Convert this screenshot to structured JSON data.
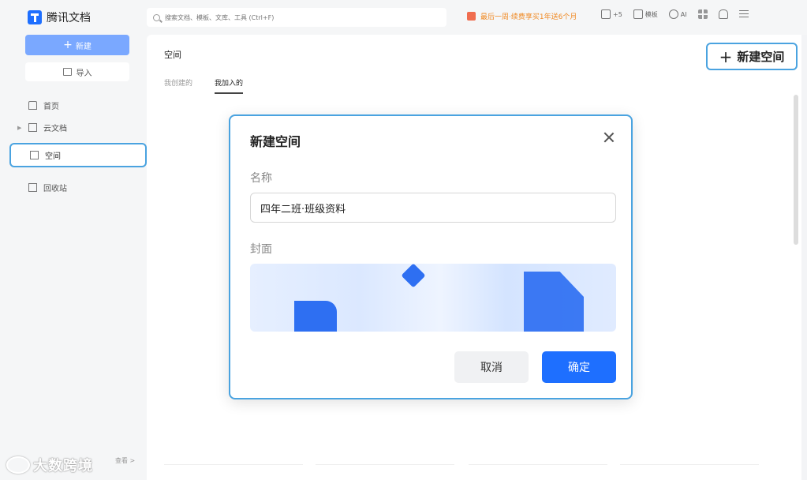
{
  "app": {
    "name": "腾讯文档"
  },
  "search": {
    "placeholder": "搜索文档、模板、文库、工具 (Ctrl+F)"
  },
  "promo": {
    "text": "最后一周·续费享买1年送6个月"
  },
  "top_tools": [
    {
      "label": "+5",
      "icon": "collab-icon"
    },
    {
      "label": "模板",
      "icon": "template-icon"
    },
    {
      "label": "AI",
      "icon": "ai-icon"
    },
    {
      "label": "",
      "icon": "apps-grid-icon"
    },
    {
      "label": "",
      "icon": "bell-icon"
    },
    {
      "label": "",
      "icon": "menu-icon"
    }
  ],
  "sidebar": {
    "new_label": "新建",
    "import_label": "导入",
    "items": [
      {
        "label": "首页",
        "icon": "home-icon"
      },
      {
        "label": "云文档",
        "icon": "doc-icon"
      },
      {
        "label": "空间",
        "icon": "space-icon"
      },
      {
        "label": "回收站",
        "icon": "trash-icon"
      }
    ],
    "bottom_link": "查看 >"
  },
  "watermark": {
    "text": "大数跨境"
  },
  "main": {
    "title": "空间",
    "tabs": [
      {
        "label": "我创建的",
        "active": false
      },
      {
        "label": "我加入的",
        "active": true
      }
    ],
    "new_space_label": "新建空间"
  },
  "dialog": {
    "title": "新建空间",
    "name_label": "名称",
    "name_value": "四年二班·班级资料",
    "cover_label": "封面",
    "cancel_label": "取消",
    "confirm_label": "确定"
  },
  "colors": {
    "primary": "#1e6fff",
    "highlight_border": "#4aa3e0",
    "promo": "#f08a24"
  }
}
